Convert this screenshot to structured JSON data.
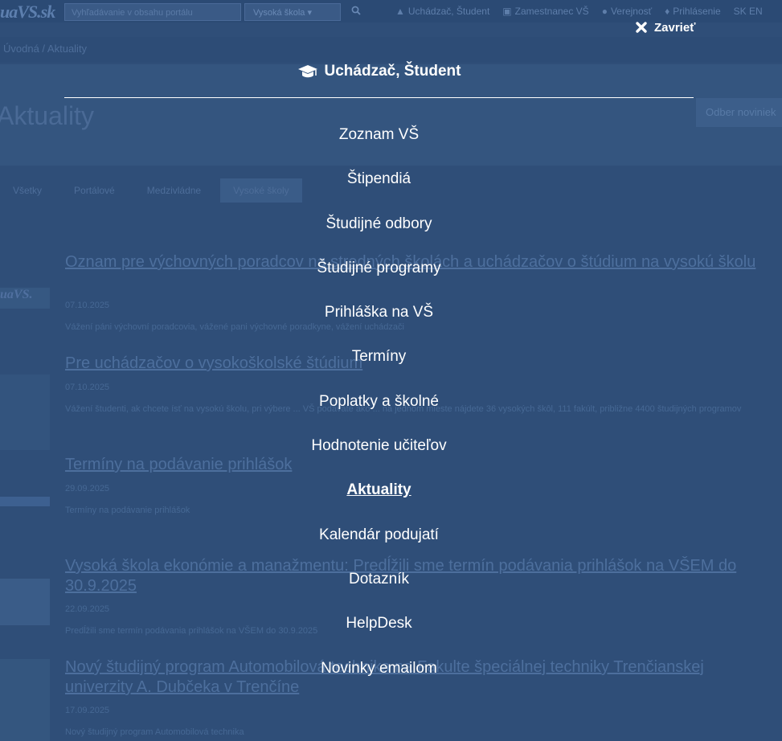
{
  "background_page": {
    "logo": "uaVS.sk",
    "search_placeholder": "Vyhľadávanie v obsahu portálu",
    "search_select": "Vysoká škola",
    "top_links": [
      {
        "icon": "graduation-cap-icon",
        "label": "Uchádzač, Študent"
      },
      {
        "icon": "building-icon",
        "label": "Zamestnanec VŠ"
      },
      {
        "icon": "globe-icon",
        "label": "Verejnosť"
      },
      {
        "icon": "user-icon",
        "label": "Prihlásenie"
      },
      {
        "icon": "",
        "label": "SK EN"
      }
    ],
    "breadcrumb": "Úvodná / Aktuality",
    "page_title": "Aktuality",
    "hero_button": "Odber noviniek",
    "filter_tabs": [
      "Všetky",
      "Portálové",
      "Medzivládne",
      "Vysoké školy"
    ],
    "news": [
      {
        "title": "Oznam pre výchovných poradcov na stredných školách a uchádzačov o štúdium na vysokú školu",
        "date": "07.10.2025",
        "desc": "Vážení páni výchovní poradcovia, vážené pani výchovné poradkyne, vážení uchádzači"
      },
      {
        "title": "Pre uchádzačov o vysokoškolské štúdium",
        "date": "07.10.2025",
        "desc": "Vážení študenti, ak chcete ísť na vysokú školu, pri výbere ... VŠ podávate ako ... na jednom mieste nájdete 36 vysokých škôl, 111 fakúlt, približne 4400 študijných programov"
      },
      {
        "title": "Termíny na podávanie prihlášok",
        "date": "29.09.2025",
        "desc": "Termíny na podávanie prihlášok"
      },
      {
        "title": "Vysoká škola ekonómie a manažmentu: Predĺžili sme termín podávania prihlášok na VŠEM do 30.9.2025",
        "date": "22.09.2025",
        "desc": "Predĺžili sme termín podávania prihlášok na VŠEM do 30.9.2025"
      },
      {
        "title": "Nový študijný program Automobilová technika na Fakulte špeciálnej techniky Trenčianskej univerzity A. Dubčeka v Trenčíne",
        "date": "17.09.2025",
        "desc": "Nový študijný program Automobilová technika"
      }
    ]
  },
  "overlay": {
    "close_label": "Zavrieť",
    "heading": "Uchádzač, Študent",
    "heading_icon": "graduation-cap-icon",
    "items": [
      {
        "label": "Zoznam VŠ",
        "active": false
      },
      {
        "label": "Štipendiá",
        "active": false
      },
      {
        "label": "Študijné odbory",
        "active": false
      },
      {
        "label": "Študijné programy",
        "active": false
      },
      {
        "label": "Prihláška na VŠ",
        "active": false
      },
      {
        "label": "Termíny",
        "active": false
      },
      {
        "label": "Poplatky a školné",
        "active": false
      },
      {
        "label": "Hodnotenie učiteľov",
        "active": false
      },
      {
        "label": "Aktuality",
        "active": true
      },
      {
        "label": "Kalendár podujatí",
        "active": false
      },
      {
        "label": "Dotazník",
        "active": false
      },
      {
        "label": "HelpDesk",
        "active": false
      },
      {
        "label": "Novinky emailom",
        "active": false
      }
    ]
  },
  "colors": {
    "overlay_bg": "#2f4e78",
    "menu_text": "#ffffff"
  }
}
